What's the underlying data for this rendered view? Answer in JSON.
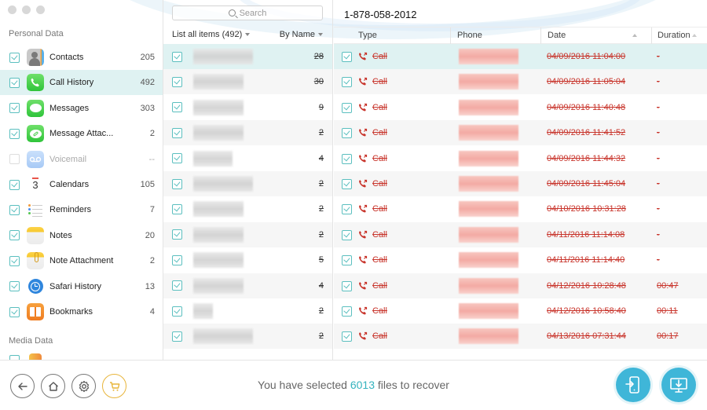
{
  "window": {
    "traffic_lights": [
      "close",
      "minimize",
      "zoom"
    ]
  },
  "sidebar": {
    "sections": [
      {
        "title": "Personal Data",
        "items": [
          {
            "label": "Contacts",
            "count": "205",
            "icon": "contacts-icon",
            "checked": true,
            "active": false,
            "disabled": false
          },
          {
            "label": "Call History",
            "count": "492",
            "icon": "phone-icon",
            "checked": true,
            "active": true,
            "disabled": false
          },
          {
            "label": "Messages",
            "count": "303",
            "icon": "messages-icon",
            "checked": true,
            "active": false,
            "disabled": false
          },
          {
            "label": "Message Attac...",
            "count": "2",
            "icon": "message-attachment-icon",
            "checked": true,
            "active": false,
            "disabled": false
          },
          {
            "label": "Voicemail",
            "count": "--",
            "icon": "voicemail-icon",
            "checked": false,
            "active": false,
            "disabled": true
          },
          {
            "label": "Calendars",
            "count": "105",
            "icon": "calendar-icon",
            "checked": true,
            "active": false,
            "disabled": false
          },
          {
            "label": "Reminders",
            "count": "7",
            "icon": "reminders-icon",
            "checked": true,
            "active": false,
            "disabled": false
          },
          {
            "label": "Notes",
            "count": "20",
            "icon": "notes-icon",
            "checked": true,
            "active": false,
            "disabled": false
          },
          {
            "label": "Note Attachment",
            "count": "2",
            "icon": "note-attachment-icon",
            "checked": true,
            "active": false,
            "disabled": false
          },
          {
            "label": "Safari History",
            "count": "13",
            "icon": "safari-history-icon",
            "checked": true,
            "active": false,
            "disabled": false
          },
          {
            "label": "Bookmarks",
            "count": "4",
            "icon": "bookmarks-icon",
            "checked": true,
            "active": false,
            "disabled": false
          }
        ]
      },
      {
        "title": "Media Data",
        "items": []
      }
    ],
    "calendar_day": "3"
  },
  "contacts_list": {
    "search_placeholder": "Search",
    "filter_label": "List all items (492)",
    "sort_label": "By Name",
    "rows": [
      {
        "count": "28",
        "checked": true,
        "active": true
      },
      {
        "count": "30",
        "checked": true,
        "active": false
      },
      {
        "count": "9",
        "checked": true,
        "active": false
      },
      {
        "count": "2",
        "checked": true,
        "active": false
      },
      {
        "count": "4",
        "checked": true,
        "active": false
      },
      {
        "count": "2",
        "checked": true,
        "active": false
      },
      {
        "count": "2",
        "checked": true,
        "active": false
      },
      {
        "count": "2",
        "checked": true,
        "active": false
      },
      {
        "count": "5",
        "checked": true,
        "active": false
      },
      {
        "count": "4",
        "checked": true,
        "active": false
      },
      {
        "count": "2",
        "checked": true,
        "active": false
      },
      {
        "count": "2",
        "checked": true,
        "active": false
      }
    ]
  },
  "detail": {
    "title": "1-878-058-2012",
    "columns": [
      "Type",
      "Phone",
      "Date",
      "Duration"
    ],
    "rows": [
      {
        "type": "Call",
        "date": "04/09/2016 11:04:00",
        "duration": "-",
        "active": true
      },
      {
        "type": "Call",
        "date": "04/09/2016 11:05:04",
        "duration": "-",
        "active": false
      },
      {
        "type": "Call",
        "date": "04/09/2016 11:40:48",
        "duration": "-",
        "active": false
      },
      {
        "type": "Call",
        "date": "04/09/2016 11:41:52",
        "duration": "-",
        "active": false
      },
      {
        "type": "Call",
        "date": "04/09/2016 11:44:32",
        "duration": "-",
        "active": false
      },
      {
        "type": "Call",
        "date": "04/09/2016 11:45:04",
        "duration": "-",
        "active": false
      },
      {
        "type": "Call",
        "date": "04/10/2016 10:31:28",
        "duration": "-",
        "active": false
      },
      {
        "type": "Call",
        "date": "04/11/2016 11:14:08",
        "duration": "-",
        "active": false
      },
      {
        "type": "Call",
        "date": "04/11/2016 11:14:40",
        "duration": "-",
        "active": false
      },
      {
        "type": "Call",
        "date": "04/12/2016 10:28:48",
        "duration": "00:47",
        "active": false
      },
      {
        "type": "Call",
        "date": "04/12/2016 10:58:40",
        "duration": "00:11",
        "active": false
      },
      {
        "type": "Call",
        "date": "04/13/2016 07:31:44",
        "duration": "00:17",
        "active": false
      }
    ]
  },
  "footer": {
    "status_prefix": "You have selected ",
    "selected_count": "6013",
    "status_suffix": " files to recover",
    "buttons": {
      "back": "back-icon",
      "home": "home-icon",
      "settings": "gear-icon",
      "cart": "cart-icon",
      "to_device": "recover-to-device-icon",
      "to_computer": "recover-to-computer-icon"
    }
  },
  "colors": {
    "accent": "#5bbfbf",
    "active_row": "#dff2f2",
    "deleted_text": "#c8342b",
    "primary_button": "#3fb6d8",
    "cart": "#e8b53b",
    "count_highlight": "#35b3be"
  }
}
